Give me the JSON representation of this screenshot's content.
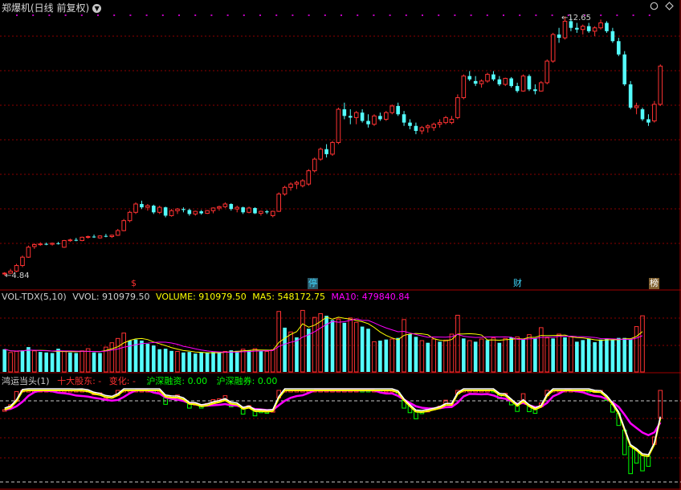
{
  "stock": {
    "title": "郑爆机(日线 前复权)",
    "price_high_label": "12.65",
    "price_low_label": "4.84"
  },
  "markers": [
    {
      "glyph": "$",
      "color": "#ff3030",
      "bg": "transparent"
    },
    {
      "glyph": "停",
      "color": "#00c8ff",
      "bg": "#306070"
    },
    {
      "glyph": "财",
      "color": "#00c8ff",
      "bg": "transparent"
    },
    {
      "glyph": "榜",
      "color": "#ffffff",
      "bg": "#806030"
    }
  ],
  "volume_panel": {
    "name": "VOL-TDX(5,10)",
    "vvol": "VVOL: 910979.50",
    "volume": "VOLUME: 910979.50",
    "ma5": "MA5: 548172.75",
    "ma10": "MA10: 479840.84"
  },
  "indicator_panel": {
    "name": "鸿运当头(1)",
    "top10": "十大股东: -",
    "change": "变化: -",
    "margin_buy": "沪深融资: 0.00",
    "margin_sell": "沪深融券: 0.00"
  },
  "colors": {
    "up": "#ff3232",
    "down": "#54fcfc",
    "grid": "#8b0000",
    "ma5": "#ffff00",
    "ma10": "#ff00ff",
    "white_line": "#ffffff",
    "bar_green": "#00ff00",
    "bar_yellow": "#ffff00"
  },
  "chart_data": {
    "type": "candlestick",
    "ohlc": [
      [
        4.9,
        4.95,
        4.84,
        4.92
      ],
      [
        4.92,
        5.05,
        4.9,
        4.98
      ],
      [
        4.98,
        5.2,
        4.95,
        5.15
      ],
      [
        5.15,
        5.45,
        5.1,
        5.4
      ],
      [
        5.4,
        5.75,
        5.38,
        5.7
      ],
      [
        5.72,
        5.82,
        5.65,
        5.78
      ],
      [
        5.78,
        5.85,
        5.74,
        5.8
      ],
      [
        5.8,
        5.84,
        5.76,
        5.79
      ],
      [
        5.79,
        5.84,
        5.75,
        5.82
      ],
      [
        5.82,
        5.86,
        5.78,
        5.8
      ],
      [
        5.7,
        5.92,
        5.68,
        5.9
      ],
      [
        5.9,
        5.96,
        5.86,
        5.92
      ],
      [
        5.92,
        5.98,
        5.88,
        5.9
      ],
      [
        5.9,
        6.02,
        5.88,
        6.0
      ],
      [
        6.0,
        6.05,
        5.96,
        6.02
      ],
      [
        6.02,
        6.08,
        5.98,
        6.0
      ],
      [
        5.98,
        6.06,
        5.96,
        6.04
      ],
      [
        6.04,
        6.1,
        6.0,
        6.02
      ],
      [
        6.02,
        6.08,
        5.98,
        6.06
      ],
      [
        6.06,
        6.25,
        6.04,
        6.2
      ],
      [
        6.2,
        6.55,
        6.18,
        6.5
      ],
      [
        6.5,
        6.8,
        6.45,
        6.75
      ],
      [
        6.75,
        7.05,
        6.7,
        7.0
      ],
      [
        7.0,
        7.1,
        6.85,
        6.9
      ],
      [
        6.9,
        7.0,
        6.8,
        6.95
      ],
      [
        6.95,
        6.98,
        6.7,
        6.75
      ],
      [
        6.75,
        6.95,
        6.7,
        6.9
      ],
      [
        6.9,
        6.92,
        6.6,
        6.65
      ],
      [
        6.65,
        6.85,
        6.62,
        6.8
      ],
      [
        6.8,
        6.88,
        6.7,
        6.85
      ],
      [
        6.85,
        6.9,
        6.75,
        6.82
      ],
      [
        6.82,
        6.86,
        6.65,
        6.7
      ],
      [
        6.7,
        6.8,
        6.65,
        6.78
      ],
      [
        6.78,
        6.82,
        6.68,
        6.72
      ],
      [
        6.72,
        6.82,
        6.7,
        6.8
      ],
      [
        6.8,
        6.9,
        6.72,
        6.88
      ],
      [
        6.88,
        6.95,
        6.8,
        6.92
      ],
      [
        6.92,
        7.05,
        6.88,
        7.0
      ],
      [
        7.0,
        7.02,
        6.8,
        6.85
      ],
      [
        6.85,
        6.95,
        6.75,
        6.9
      ],
      [
        6.9,
        6.92,
        6.7,
        6.75
      ],
      [
        6.75,
        6.92,
        6.72,
        6.88
      ],
      [
        6.88,
        6.9,
        6.7,
        6.72
      ],
      [
        6.72,
        6.8,
        6.65,
        6.78
      ],
      [
        6.78,
        6.82,
        6.7,
        6.75
      ],
      [
        6.65,
        6.8,
        6.6,
        6.78
      ],
      [
        6.78,
        7.35,
        6.76,
        7.3
      ],
      [
        7.3,
        7.55,
        7.25,
        7.5
      ],
      [
        7.5,
        7.65,
        7.4,
        7.6
      ],
      [
        7.6,
        7.7,
        7.45,
        7.65
      ],
      [
        7.55,
        7.75,
        7.5,
        7.7
      ],
      [
        7.6,
        8.05,
        7.55,
        8.0
      ],
      [
        8.0,
        8.4,
        7.95,
        8.35
      ],
      [
        8.35,
        8.7,
        8.3,
        8.65
      ],
      [
        8.65,
        8.8,
        8.4,
        8.5
      ],
      [
        8.5,
        8.9,
        8.45,
        8.85
      ],
      [
        8.85,
        9.9,
        8.8,
        9.85
      ],
      [
        9.85,
        10.05,
        9.55,
        9.65
      ],
      [
        9.65,
        9.85,
        9.4,
        9.6
      ],
      [
        9.6,
        9.8,
        9.4,
        9.75
      ],
      [
        9.75,
        9.85,
        9.45,
        9.5
      ],
      [
        9.5,
        9.7,
        9.3,
        9.4
      ],
      [
        9.4,
        9.7,
        9.35,
        9.65
      ],
      [
        9.65,
        9.75,
        9.5,
        9.55
      ],
      [
        9.55,
        9.8,
        9.5,
        9.75
      ],
      [
        9.75,
        10.0,
        9.7,
        9.95
      ],
      [
        9.95,
        10.05,
        9.65,
        9.7
      ],
      [
        9.7,
        9.8,
        9.35,
        9.45
      ],
      [
        9.45,
        9.55,
        9.25,
        9.35
      ],
      [
        9.35,
        9.45,
        9.1,
        9.2
      ],
      [
        9.2,
        9.35,
        9.1,
        9.3
      ],
      [
        9.3,
        9.4,
        9.15,
        9.35
      ],
      [
        9.3,
        9.45,
        9.2,
        9.4
      ],
      [
        9.4,
        9.55,
        9.3,
        9.45
      ],
      [
        9.45,
        9.65,
        9.4,
        9.6
      ],
      [
        9.45,
        9.65,
        9.4,
        9.55
      ],
      [
        9.6,
        10.3,
        9.55,
        10.2
      ],
      [
        10.2,
        10.9,
        10.15,
        10.85
      ],
      [
        10.85,
        11.0,
        10.7,
        10.75
      ],
      [
        10.7,
        10.85,
        10.55,
        10.62
      ],
      [
        10.62,
        10.75,
        10.5,
        10.7
      ],
      [
        10.7,
        10.95,
        10.65,
        10.9
      ],
      [
        10.9,
        11.0,
        10.7,
        10.75
      ],
      [
        10.75,
        10.85,
        10.55,
        10.6
      ],
      [
        10.6,
        10.8,
        10.55,
        10.78
      ],
      [
        10.78,
        10.82,
        10.5,
        10.55
      ],
      [
        10.55,
        10.65,
        10.35,
        10.4
      ],
      [
        10.4,
        10.9,
        10.38,
        10.85
      ],
      [
        10.85,
        10.9,
        10.4,
        10.45
      ],
      [
        10.45,
        10.6,
        10.3,
        10.4
      ],
      [
        10.4,
        10.7,
        10.38,
        10.65
      ],
      [
        10.65,
        11.35,
        10.6,
        11.3
      ],
      [
        11.3,
        12.15,
        11.25,
        12.1
      ],
      [
        12.1,
        12.3,
        11.85,
        12.0
      ],
      [
        12.0,
        12.65,
        11.95,
        12.5
      ],
      [
        12.5,
        12.6,
        12.2,
        12.3
      ],
      [
        12.3,
        12.45,
        12.15,
        12.25
      ],
      [
        12.25,
        12.4,
        12.1,
        12.35
      ],
      [
        12.35,
        12.45,
        12.15,
        12.2
      ],
      [
        12.2,
        12.35,
        12.05,
        12.3
      ],
      [
        12.3,
        12.55,
        12.25,
        12.45
      ],
      [
        12.45,
        12.5,
        12.15,
        12.2
      ],
      [
        12.2,
        12.3,
        11.85,
        11.9
      ],
      [
        11.9,
        12.0,
        11.45,
        11.5
      ],
      [
        11.5,
        11.6,
        10.55,
        10.6
      ],
      [
        10.6,
        10.7,
        9.85,
        9.9
      ],
      [
        9.9,
        10.05,
        9.7,
        9.95
      ],
      [
        9.85,
        9.9,
        9.5,
        9.55
      ],
      [
        9.55,
        9.7,
        9.35,
        9.45
      ],
      [
        9.5,
        10.1,
        9.45,
        10.0
      ],
      [
        10.0,
        11.2,
        9.95,
        11.15
      ]
    ],
    "volume": [
      [
        false,
        210
      ],
      [
        true,
        180
      ],
      [
        true,
        190
      ],
      [
        false,
        200
      ],
      [
        false,
        230
      ],
      [
        true,
        195
      ],
      [
        false,
        185
      ],
      [
        false,
        180
      ],
      [
        false,
        175
      ],
      [
        false,
        215
      ],
      [
        true,
        190
      ],
      [
        false,
        180
      ],
      [
        false,
        175
      ],
      [
        true,
        195
      ],
      [
        true,
        215
      ],
      [
        false,
        180
      ],
      [
        false,
        175
      ],
      [
        true,
        230
      ],
      [
        true,
        270
      ],
      [
        true,
        310
      ],
      [
        true,
        360
      ],
      [
        false,
        290
      ],
      [
        false,
        300
      ],
      [
        false,
        290
      ],
      [
        false,
        260
      ],
      [
        false,
        245
      ],
      [
        false,
        210
      ],
      [
        false,
        215
      ],
      [
        false,
        195
      ],
      [
        true,
        190
      ],
      [
        false,
        180
      ],
      [
        false,
        185
      ],
      [
        false,
        170
      ],
      [
        false,
        180
      ],
      [
        false,
        175
      ],
      [
        false,
        185
      ],
      [
        false,
        180
      ],
      [
        true,
        190
      ],
      [
        false,
        200
      ],
      [
        false,
        195
      ],
      [
        true,
        210
      ],
      [
        false,
        200
      ],
      [
        true,
        215
      ],
      [
        false,
        195
      ],
      [
        true,
        190
      ],
      [
        true,
        205
      ],
      [
        true,
        560
      ],
      [
        false,
        410
      ],
      [
        true,
        370
      ],
      [
        false,
        320
      ],
      [
        true,
        570
      ],
      [
        false,
        400
      ],
      [
        true,
        505
      ],
      [
        true,
        540
      ],
      [
        false,
        520
      ],
      [
        false,
        480
      ],
      [
        true,
        490
      ],
      [
        false,
        455
      ],
      [
        true,
        500
      ],
      [
        true,
        460
      ],
      [
        false,
        420
      ],
      [
        false,
        400
      ],
      [
        true,
        280
      ],
      [
        false,
        290
      ],
      [
        false,
        300
      ],
      [
        true,
        305
      ],
      [
        false,
        315
      ],
      [
        true,
        485
      ],
      [
        false,
        350
      ],
      [
        false,
        325
      ],
      [
        true,
        290
      ],
      [
        false,
        270
      ],
      [
        true,
        305
      ],
      [
        false,
        280
      ],
      [
        true,
        295
      ],
      [
        true,
        350
      ],
      [
        true,
        525
      ],
      [
        false,
        310
      ],
      [
        true,
        290
      ],
      [
        false,
        280
      ],
      [
        true,
        305
      ],
      [
        false,
        295
      ],
      [
        true,
        315
      ],
      [
        false,
        270
      ],
      [
        true,
        310
      ],
      [
        false,
        320
      ],
      [
        true,
        325
      ],
      [
        false,
        300
      ],
      [
        true,
        345
      ],
      [
        false,
        310
      ],
      [
        true,
        410
      ],
      [
        true,
        315
      ],
      [
        false,
        310
      ],
      [
        true,
        350
      ],
      [
        false,
        320
      ],
      [
        true,
        330
      ],
      [
        false,
        280
      ],
      [
        false,
        295
      ],
      [
        false,
        310
      ],
      [
        false,
        275
      ],
      [
        false,
        300
      ],
      [
        false,
        310
      ],
      [
        false,
        295
      ],
      [
        false,
        315
      ],
      [
        false,
        315
      ],
      [
        false,
        300
      ],
      [
        true,
        420
      ],
      [
        true,
        520
      ]
    ],
    "price_range": [
      4.8,
      12.8
    ],
    "volume_max": 640
  }
}
